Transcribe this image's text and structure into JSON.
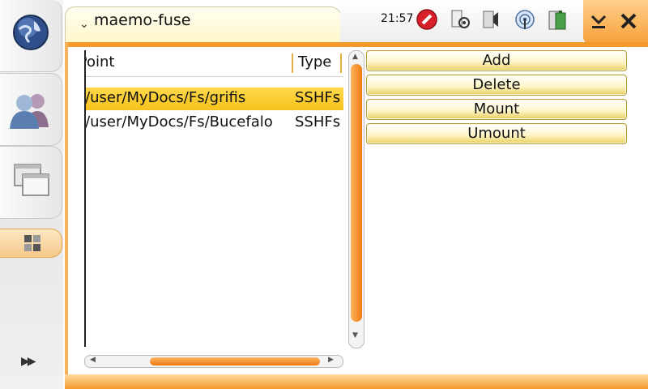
{
  "window": {
    "title": "maemo-fuse",
    "clock": "21:57"
  },
  "status_icons": [
    "no-entry-icon",
    "settings-icon",
    "volume-icon",
    "wifi-icon",
    "battery-icon"
  ],
  "list": {
    "columns": [
      "t Point",
      "Type"
    ],
    "rows": [
      {
        "mount": "e/user/MyDocs/Fs/grifis",
        "type": "SSHFs",
        "selected": true
      },
      {
        "mount": "e/user/MyDocs/Fs/Bucefalo",
        "type": "SSHFs",
        "selected": false
      }
    ]
  },
  "buttons": {
    "add": "Add",
    "delete": "Delete",
    "mount": "Mount",
    "umount": "Umount"
  },
  "colors": {
    "accent": "#f39a2b",
    "selection": "#ffd84a"
  }
}
